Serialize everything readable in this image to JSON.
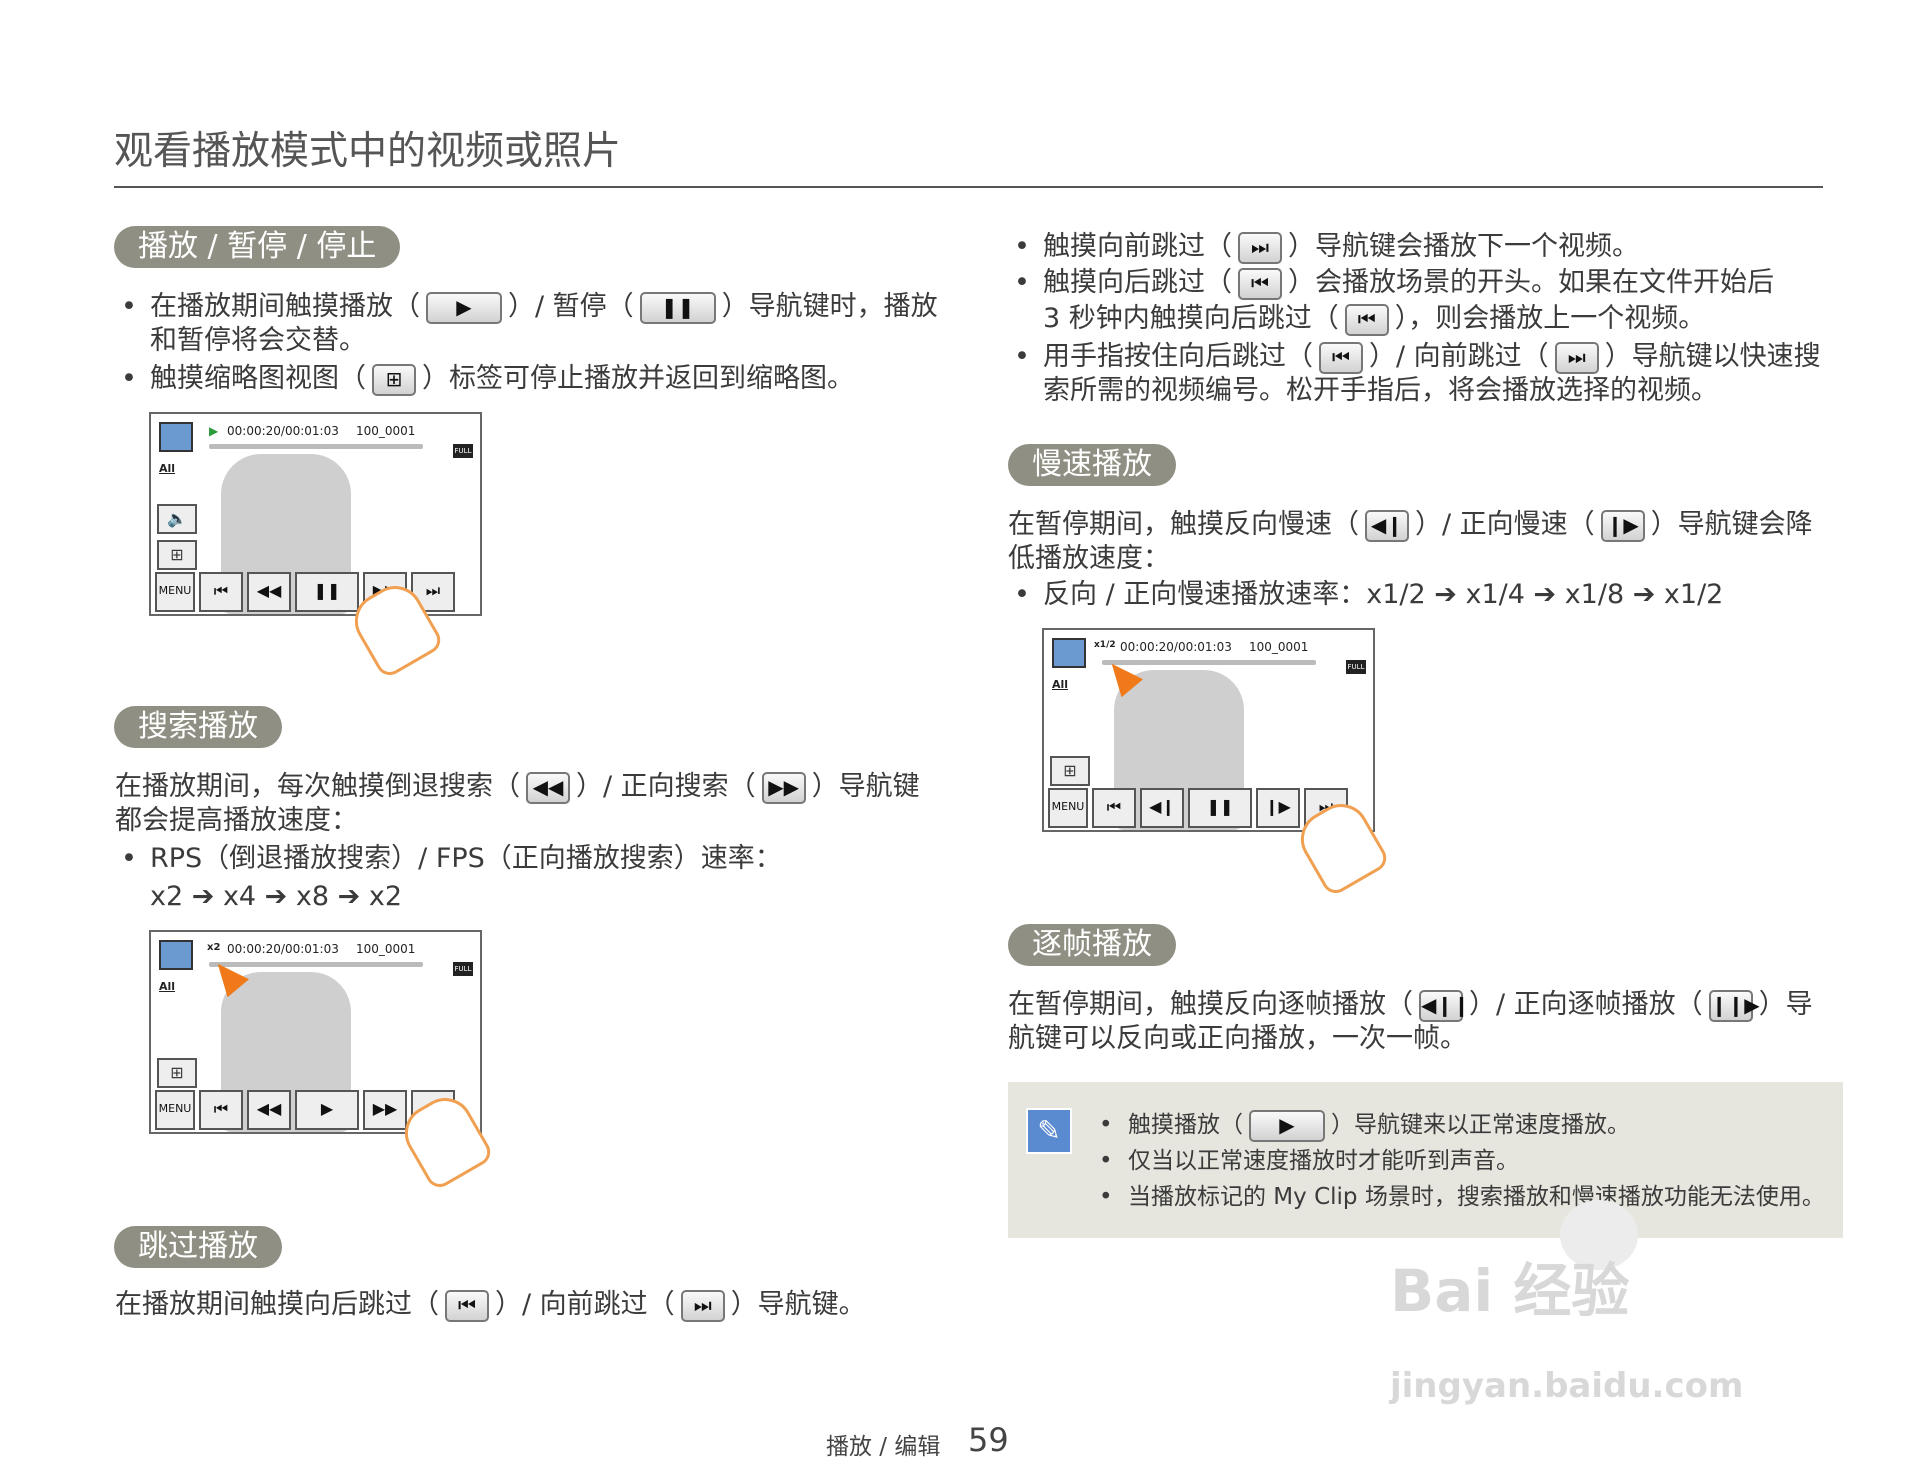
{
  "title": "观看播放模式中的视频或照片",
  "sections": {
    "play": {
      "heading": "播放 / 暂停 / 停止",
      "b1_a": "在播放期间触摸播放（",
      "b1_b": "）/ 暂停（",
      "b1_c": "）导航键时，播放",
      "b1_d": "和暂停将会交替。",
      "b2_a": "触摸缩略图视图（",
      "b2_b": "）标签可停止播放并返回到缩略图。"
    },
    "search": {
      "heading": "搜索播放",
      "p_a": "在播放期间，每次触摸倒退搜索（",
      "p_b": "）/ 正向搜索（",
      "p_c": "）导航键",
      "p_d": "都会提高播放速度：",
      "b1_a": "RPS（倒退播放搜索）/ FPS（正向播放搜索）速率：",
      "b1_b": "x2 ➔ x4 ➔ x8 ➔ x2"
    },
    "skip": {
      "heading": "跳过播放",
      "p_a": "在播放期间触摸向后跳过（",
      "p_b": "）/ 向前跳过（",
      "p_c": "）导航键。",
      "b1_a": "触摸向前跳过（",
      "b1_b": "）导航键会播放下一个视频。",
      "b2_a": "触摸向后跳过（",
      "b2_b": "）会播放场景的开头。如果在文件开始后",
      "b2_c": "3 秒钟内触摸向后跳过（",
      "b2_d": "），则会播放上一个视频。",
      "b3_a": "用手指按住向后跳过（",
      "b3_b": "）/ 向前跳过（",
      "b3_c": "）导航键以快速搜",
      "b3_d": "索所需的视频编号。松开手指后，将会播放选择的视频。"
    },
    "slow": {
      "heading": "慢速播放",
      "p_a": "在暂停期间，触摸反向慢速（",
      "p_b": "）/ 正向慢速（",
      "p_c": "）导航键会降",
      "p_d": "低播放速度：",
      "b1": "反向 / 正向慢速播放速率：x1/2 ➔ x1/4 ➔ x1/8 ➔ x1/2"
    },
    "frame": {
      "heading": "逐帧播放",
      "p_a": "在暂停期间，触摸反向逐帧播放（",
      "p_b": "）/ 正向逐帧播放（",
      "p_c": "）导",
      "p_d": "航键可以反向或正向播放，一次一帧。"
    }
  },
  "note": {
    "n1_a": "触摸播放（",
    "n1_b": "）导航键来以正常速度播放。",
    "n2": "仅当以正常速度播放时才能听到声音。",
    "n3": "当播放标记的 My Clip 场景时，搜索播放和慢速播放功能无法使用。"
  },
  "screen": {
    "time": "00:00:20/00:01:03",
    "file": "100_0001",
    "all": "All",
    "menu": "MENU",
    "full": "FULL HD",
    "rate_search": "x2",
    "rate_slow": "x1/2"
  },
  "icons": {
    "play": "▶",
    "pause": "❚❚",
    "thumb": "⊞",
    "rew": "◀◀",
    "ff": "▶▶",
    "prev": "⏮",
    "next": "⏭",
    "slow_rev": "◀❙",
    "slow_fwd": "❙▶",
    "frame_rev": "◀❙❙",
    "frame_fwd": "❙❙▶",
    "vol": "🔈"
  },
  "footer": {
    "label": "播放 / 编辑",
    "page": "59"
  },
  "watermark": {
    "main": "Bai 经验",
    "url": "jingyan.baidu.com"
  }
}
